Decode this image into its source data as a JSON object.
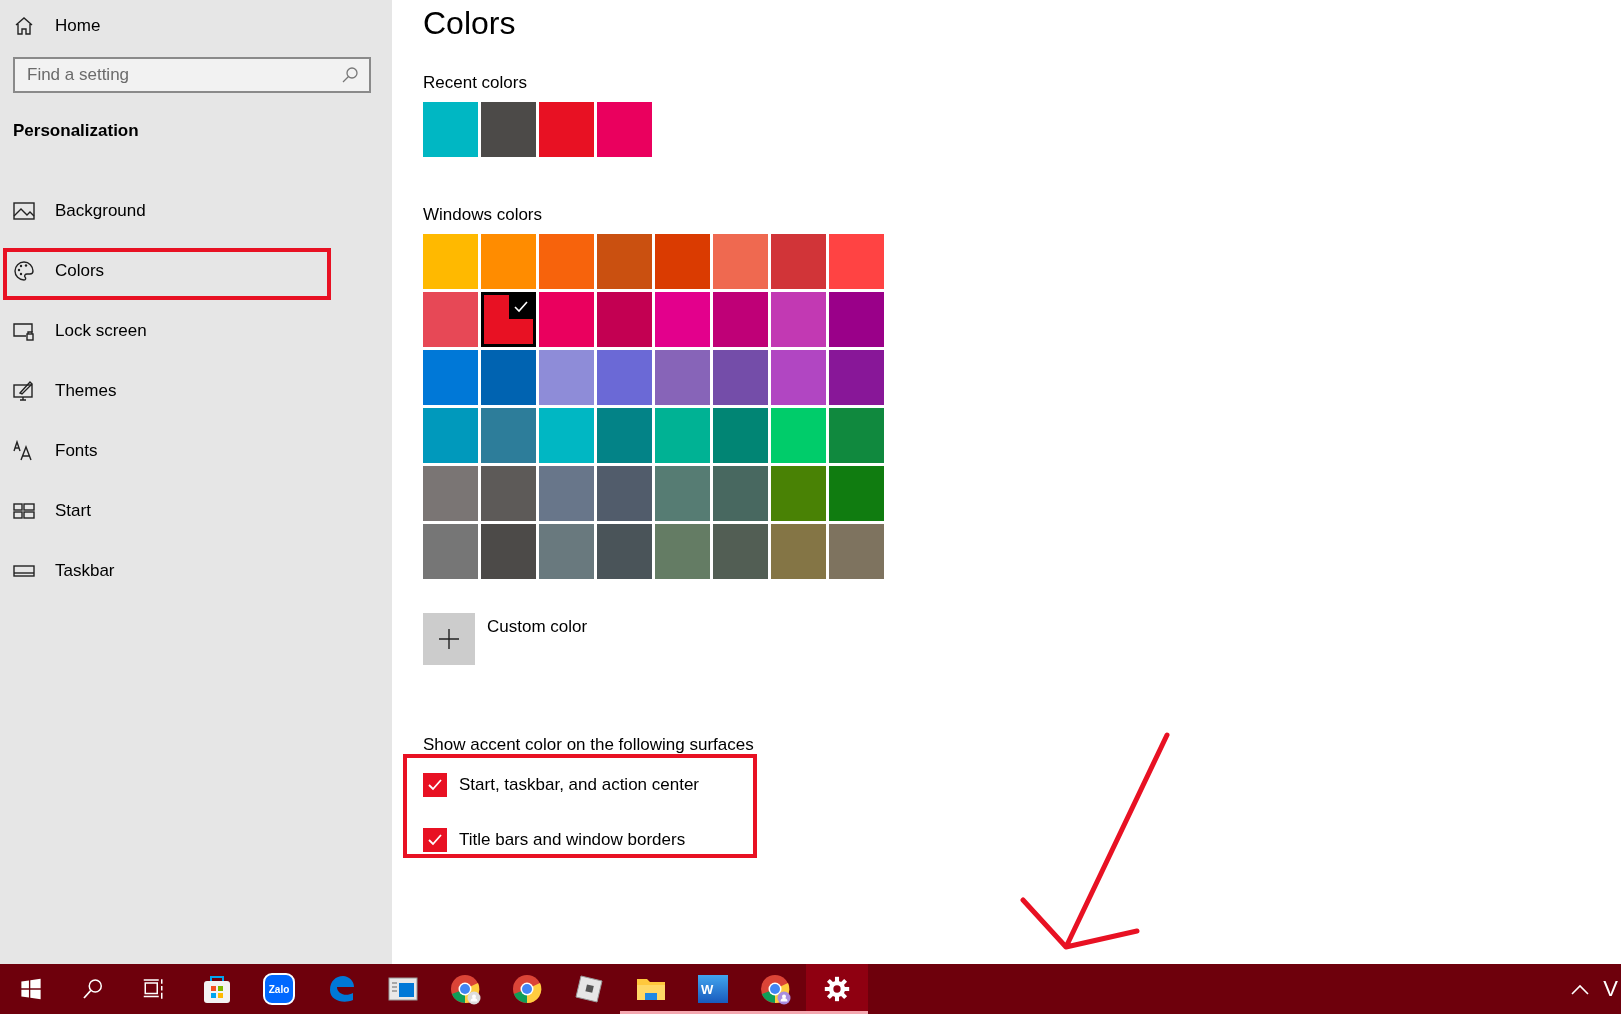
{
  "sidebar": {
    "home": "Home",
    "search": {
      "placeholder": "Find a setting"
    },
    "section": "Personalization",
    "items": [
      {
        "label": "Background",
        "kind": "picture"
      },
      {
        "label": "Colors",
        "kind": "palette"
      },
      {
        "label": "Lock screen",
        "kind": "lock"
      },
      {
        "label": "Themes",
        "kind": "themes"
      },
      {
        "label": "Fonts",
        "kind": "fonts"
      },
      {
        "label": "Start",
        "kind": "start"
      },
      {
        "label": "Taskbar",
        "kind": "taskbar"
      }
    ]
  },
  "page": {
    "title": "Colors",
    "recent_label": "Recent colors",
    "recent_colors": [
      {
        "color": "#00b7c3"
      },
      {
        "color": "#4c4a48"
      },
      {
        "color": "#e81123"
      },
      {
        "color": "#ea005e"
      }
    ],
    "windows_label": "Windows colors",
    "windows_colors": [
      {
        "color": "#ffb900",
        "selected": false
      },
      {
        "color": "#ff8c00",
        "selected": false
      },
      {
        "color": "#f7630c",
        "selected": false
      },
      {
        "color": "#ca5010",
        "selected": false
      },
      {
        "color": "#da3b01",
        "selected": false
      },
      {
        "color": "#ef6950",
        "selected": false
      },
      {
        "color": "#d13438",
        "selected": false
      },
      {
        "color": "#ff4343",
        "selected": false
      },
      {
        "color": "#e74856",
        "selected": false
      },
      {
        "color": "#e81123",
        "selected": true
      },
      {
        "color": "#ea005e",
        "selected": false
      },
      {
        "color": "#c30052",
        "selected": false
      },
      {
        "color": "#e3008c",
        "selected": false
      },
      {
        "color": "#bf0077",
        "selected": false
      },
      {
        "color": "#c239b3",
        "selected": false
      },
      {
        "color": "#9a0089",
        "selected": false
      },
      {
        "color": "#0078d7",
        "selected": false
      },
      {
        "color": "#0063b1",
        "selected": false
      },
      {
        "color": "#8e8cd8",
        "selected": false
      },
      {
        "color": "#6b69d6",
        "selected": false
      },
      {
        "color": "#8764b8",
        "selected": false
      },
      {
        "color": "#744da9",
        "selected": false
      },
      {
        "color": "#b146c2",
        "selected": false
      },
      {
        "color": "#881798",
        "selected": false
      },
      {
        "color": "#0099bc",
        "selected": false
      },
      {
        "color": "#2d7d9a",
        "selected": false
      },
      {
        "color": "#00b7c3",
        "selected": false
      },
      {
        "color": "#038387",
        "selected": false
      },
      {
        "color": "#00b294",
        "selected": false
      },
      {
        "color": "#018574",
        "selected": false
      },
      {
        "color": "#00cc6a",
        "selected": false
      },
      {
        "color": "#10893e",
        "selected": false
      },
      {
        "color": "#7a7574",
        "selected": false
      },
      {
        "color": "#5d5a58",
        "selected": false
      },
      {
        "color": "#68768a",
        "selected": false
      },
      {
        "color": "#515c6b",
        "selected": false
      },
      {
        "color": "#567c73",
        "selected": false
      },
      {
        "color": "#486860",
        "selected": false
      },
      {
        "color": "#498205",
        "selected": false
      },
      {
        "color": "#107c10",
        "selected": false
      },
      {
        "color": "#767676",
        "selected": false
      },
      {
        "color": "#4c4a48",
        "selected": false
      },
      {
        "color": "#69797e",
        "selected": false
      },
      {
        "color": "#4a5459",
        "selected": false
      },
      {
        "color": "#647c64",
        "selected": false
      },
      {
        "color": "#525e54",
        "selected": false
      },
      {
        "color": "#847545",
        "selected": false
      },
      {
        "color": "#7e735f",
        "selected": false
      }
    ],
    "custom_color": "Custom color",
    "surfaces_label": "Show accent color on the following surfaces",
    "surfaces": [
      {
        "label": "Start, taskbar, and action center",
        "checked": true
      },
      {
        "label": "Title bars and window borders",
        "checked": true
      }
    ]
  },
  "taskbar": {
    "apps": [
      {
        "kind": "windows",
        "running": false,
        "selected": false
      },
      {
        "kind": "search",
        "running": false,
        "selected": false
      },
      {
        "kind": "taskview",
        "running": false,
        "selected": false
      },
      {
        "kind": "store",
        "running": false,
        "selected": false
      },
      {
        "kind": "zalo",
        "text": "Zalo",
        "running": false,
        "selected": false
      },
      {
        "kind": "edge",
        "running": false,
        "selected": false
      },
      {
        "kind": "window",
        "running": false,
        "selected": false
      },
      {
        "kind": "chrome-user",
        "running": false,
        "selected": false
      },
      {
        "kind": "chrome",
        "running": false,
        "selected": false
      },
      {
        "kind": "cube",
        "running": false,
        "selected": false
      },
      {
        "kind": "folder",
        "running": true,
        "selected": false
      },
      {
        "kind": "word",
        "text": "W",
        "running": true,
        "selected": false
      },
      {
        "kind": "chrome-profile",
        "running": true,
        "selected": false
      },
      {
        "kind": "settings",
        "running": true,
        "selected": true
      }
    ],
    "tray_text": "V"
  }
}
